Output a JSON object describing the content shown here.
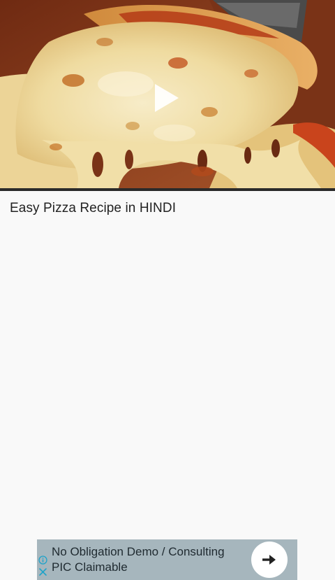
{
  "video": {
    "title": "Easy Pizza Recipe in HINDI",
    "play_icon": "play-icon"
  },
  "ad": {
    "line1": "No Obligation Demo / Consulting",
    "line2": "PIC Claimable",
    "info_icon": "info-icon",
    "close_icon": "close-icon",
    "cta_icon": "arrow-right-icon"
  },
  "colors": {
    "background": "#f9f9f9",
    "ad_background": "#a6b6bd",
    "title_text": "#222222",
    "ad_icon_accent": "#1fa3c9"
  }
}
